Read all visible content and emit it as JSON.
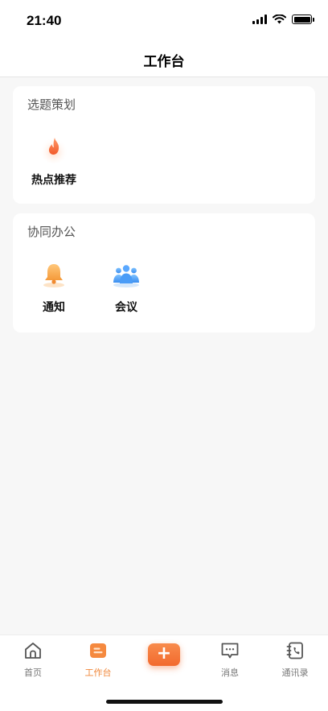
{
  "status_bar": {
    "time": "21:40"
  },
  "header": {
    "title": "工作台"
  },
  "sections": [
    {
      "title": "选题策划",
      "items": [
        {
          "label": "热点推荐",
          "icon": "flame-icon"
        }
      ]
    },
    {
      "title": "协同办公",
      "items": [
        {
          "label": "通知",
          "icon": "bell-icon"
        },
        {
          "label": "会议",
          "icon": "people-icon"
        }
      ]
    }
  ],
  "tabbar": {
    "items": [
      {
        "label": "首页",
        "icon": "home-icon"
      },
      {
        "label": "工作台",
        "icon": "workbench-icon",
        "active": true
      },
      {
        "label": "",
        "icon": "plus-icon"
      },
      {
        "label": "消息",
        "icon": "message-icon"
      },
      {
        "label": "通讯录",
        "icon": "contacts-icon"
      }
    ],
    "plus_symbol": "+"
  },
  "colors": {
    "accent": "#f0873a",
    "background": "#f7f7f7",
    "card": "#ffffff"
  }
}
